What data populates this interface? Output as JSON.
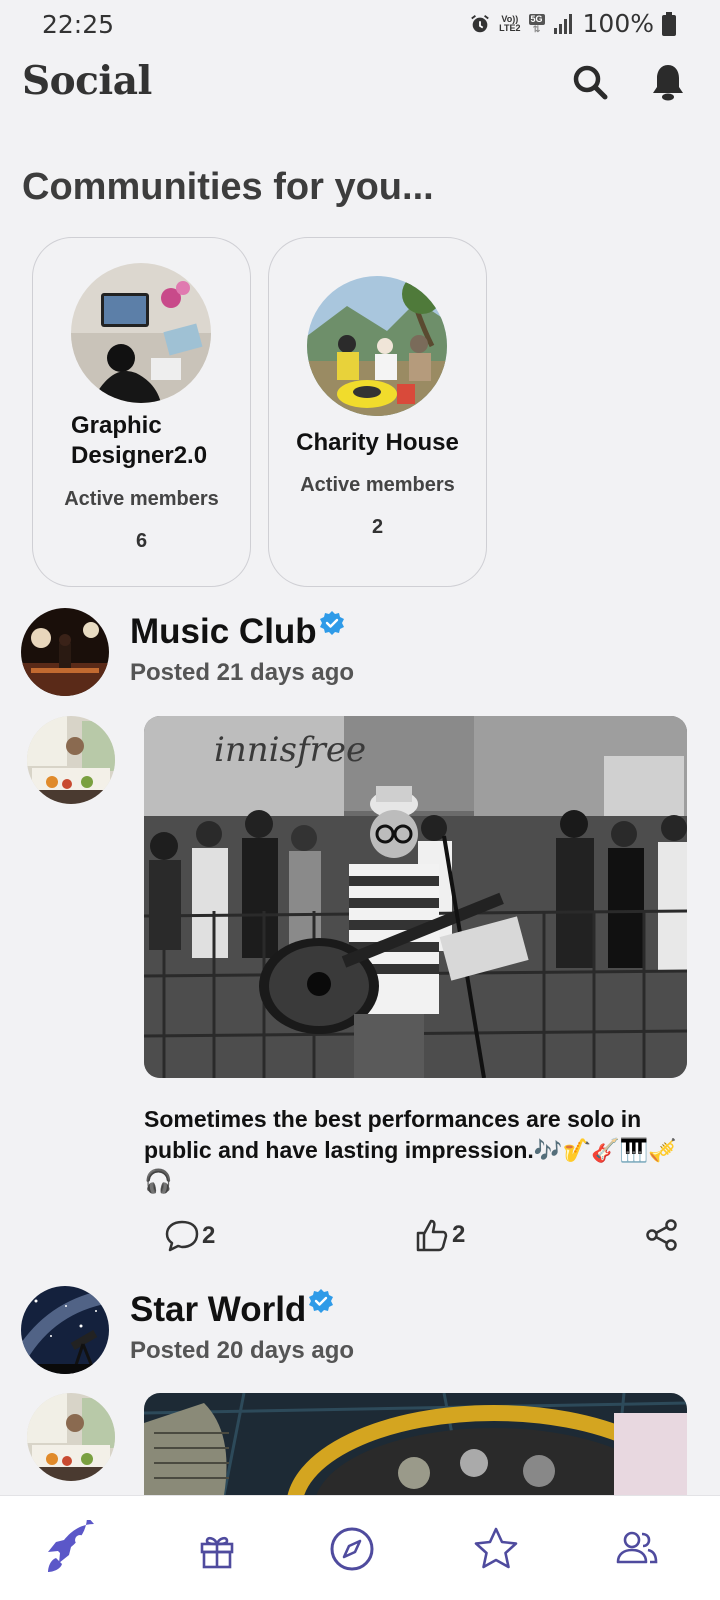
{
  "status_bar": {
    "time": "22:25",
    "volte": "Vo))",
    "lte": "LTE2",
    "net": "5G",
    "battery_pct": "100%"
  },
  "header": {
    "title": "Social"
  },
  "communities": {
    "title": "Communities for you...",
    "items": [
      {
        "name": "Graphic Designer2.0",
        "members_label": "Active members",
        "members_count": "6"
      },
      {
        "name": "Charity House",
        "members_label": "Active members",
        "members_count": "2"
      }
    ]
  },
  "posts": [
    {
      "community": "Music Club",
      "posted": "Posted 21 days ago",
      "caption": "Sometimes the best performances are solo in public and have lasting impression.🎶🎷🎸🎹🎺🎧",
      "comments": "2",
      "likes": "2",
      "image_text": "innisfree"
    },
    {
      "community": "Star World",
      "posted": "Posted 20 days ago"
    }
  ],
  "icons": {
    "search": "search-icon",
    "notifications": "bell-icon",
    "verified": "verified-badge-icon",
    "comment": "comment-icon",
    "like": "thumbs-up-icon",
    "share": "share-icon",
    "nav": [
      "rocket-icon",
      "gift-icon",
      "compass-icon",
      "star-icon",
      "people-icon"
    ]
  },
  "colors": {
    "accent": "#5b57c8",
    "verified": "#2f9be8",
    "nav_icon": "#4f4b9e"
  }
}
